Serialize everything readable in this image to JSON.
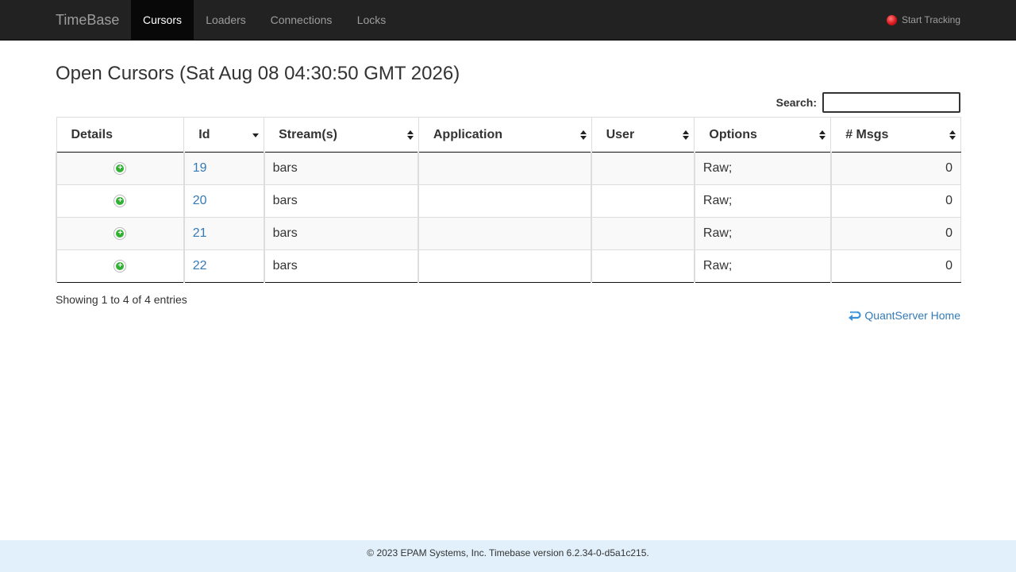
{
  "navbar": {
    "brand": "TimeBase",
    "items": [
      {
        "label": "Cursors",
        "active": true
      },
      {
        "label": "Loaders",
        "active": false
      },
      {
        "label": "Connections",
        "active": false
      },
      {
        "label": "Locks",
        "active": false
      }
    ],
    "tracking_label": "Start Tracking",
    "tracking_icon": "record-icon"
  },
  "page": {
    "title": "Open Cursors (Sat Aug 08 04:30:50 GMT 2026)"
  },
  "search": {
    "label": "Search:",
    "value": "",
    "placeholder": ""
  },
  "table": {
    "columns": [
      "Details",
      "Id",
      "Stream(s)",
      "Application",
      "User",
      "Options",
      "# Msgs"
    ],
    "rows": [
      {
        "id": "19",
        "streams": "bars",
        "application": "",
        "user": "",
        "options": "Raw;",
        "msgs": "0"
      },
      {
        "id": "20",
        "streams": "bars",
        "application": "",
        "user": "",
        "options": "Raw;",
        "msgs": "0"
      },
      {
        "id": "21",
        "streams": "bars",
        "application": "",
        "user": "",
        "options": "Raw;",
        "msgs": "0"
      },
      {
        "id": "22",
        "streams": "bars",
        "application": "",
        "user": "",
        "options": "Raw;",
        "msgs": "0"
      }
    ],
    "info": "Showing 1 to 4 of 4 entries"
  },
  "home_link": "QuantServer Home",
  "footer": "© 2023 EPAM Systems, Inc. Timebase version 6.2.34-0-d5a1c215.",
  "colors": {
    "navbar_bg": "#222222",
    "link": "#337ab7",
    "footer_bg": "#e1f0fa",
    "details_icon": "#31b131"
  }
}
